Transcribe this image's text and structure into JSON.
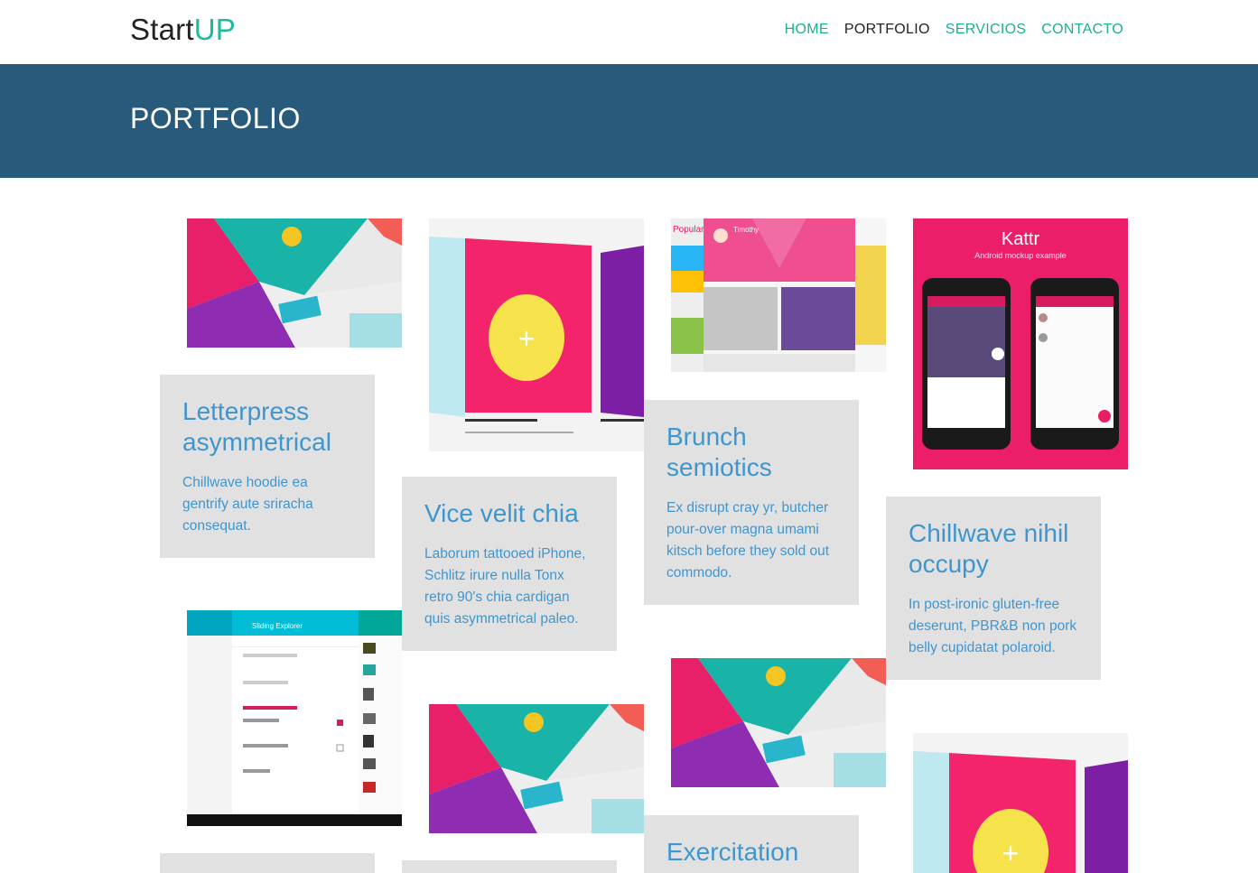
{
  "brand": {
    "name_dark": "Start",
    "name_accent": "UP"
  },
  "nav": {
    "home": "HOME",
    "portfolio": "PORTFOLIO",
    "servicios": "SERVICIOS",
    "contacto": "CONTACTO"
  },
  "banner": {
    "title": "PORTFOLIO"
  },
  "projects": [
    {
      "title": "Letterpress asymmetrical",
      "desc": "Chillwave hoodie ea gentrify aute sriracha consequat."
    },
    {
      "title": "Vice velit chia",
      "desc": "Laborum tattooed iPhone, Schlitz irure nulla Tonx retro 90's chia cardigan quis asymmetrical paleo."
    },
    {
      "title": "Brunch semiotics",
      "desc": "Ex disrupt cray yr, butcher pour-over magna umami kitsch before they sold out commodo."
    },
    {
      "title": "Chillwave nihil occupy",
      "desc": "In post-ironic gluten-free deserunt, PBR&B non pork belly cupidatat polaroid."
    },
    {
      "title": "Exercitation"
    }
  ],
  "thumb_text": {
    "kattr_title": "Kattr",
    "kattr_sub": "Android mockup example",
    "dribbble_tab": "Popular",
    "dribbble_user": "Timothy",
    "sliding_title": "Sliding Explorer",
    "plus": "+"
  },
  "colors": {
    "accent": "#1abc9c",
    "banner": "#285a7b",
    "card_bg": "#e1e1e1",
    "card_text": "#3f96cf"
  }
}
